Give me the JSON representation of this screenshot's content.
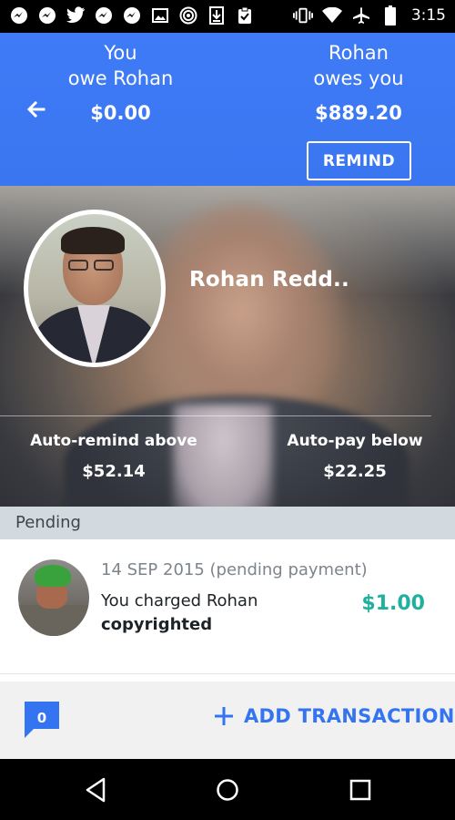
{
  "status_bar": {
    "time": "3:15",
    "left_icons": [
      "messenger-icon",
      "messenger-icon",
      "twitter-icon",
      "messenger-icon",
      "messenger-icon",
      "image-icon",
      "hotspot-icon",
      "download-icon",
      "clipboard-check-icon"
    ],
    "right_icons": [
      "vibrate-icon",
      "wifi-icon",
      "airplane-icon",
      "battery-icon"
    ]
  },
  "header": {
    "you_owe_label_line1": "You",
    "you_owe_label_line2": "owe Rohan",
    "you_owe_amount": "$0.00",
    "owes_you_label_line1": "Rohan",
    "owes_you_label_line2": "owes you",
    "owes_you_amount": "$889.20",
    "remind_label": "REMIND"
  },
  "profile": {
    "name": "Rohan Redd..",
    "auto_remind_label": "Auto-remind above",
    "auto_remind_value": "$52.14",
    "auto_pay_label": "Auto-pay below",
    "auto_pay_value": "$22.25"
  },
  "pending": {
    "section_label": "Pending",
    "transactions": [
      {
        "date": "14 SEP 2015 (pending payment)",
        "description": "You charged Rohan",
        "note": "copyrighted",
        "amount": "$1.00",
        "amount_color": "#1fb09e"
      }
    ]
  },
  "bottom_bar": {
    "chat_count": "0",
    "add_transaction_label": "ADD TRANSACTION"
  },
  "colors": {
    "header_blue": "#3d79f4",
    "accent_blue": "#3574f0",
    "amount_green": "#1fb09e"
  }
}
